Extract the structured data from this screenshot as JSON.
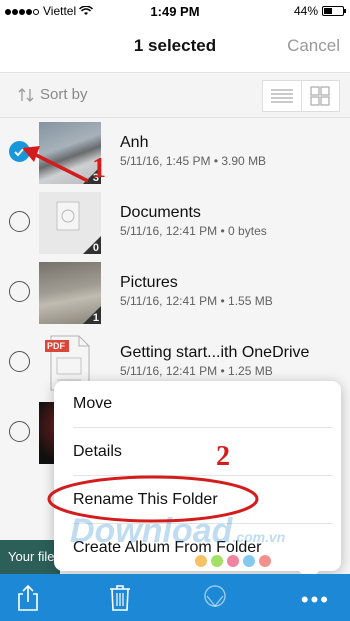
{
  "status": {
    "carrier": "Viettel",
    "time": "1:49 PM",
    "battery": "44%"
  },
  "nav": {
    "title": "1 selected",
    "cancel": "Cancel"
  },
  "sort": {
    "label": "Sort by"
  },
  "items": [
    {
      "name": "Anh",
      "meta": "5/11/16, 1:45 PM • 3.90 MB",
      "count": "3",
      "selected": true
    },
    {
      "name": "Documents",
      "meta": "5/11/16, 12:41 PM • 0 bytes",
      "count": "0",
      "selected": false
    },
    {
      "name": "Pictures",
      "meta": "5/11/16, 12:41 PM • 1.55 MB",
      "count": "1",
      "selected": false
    },
    {
      "name": "Getting start...ith OneDrive",
      "meta": "5/11/16, 12:41 PM • 1.25 MB",
      "count": "",
      "selected": false,
      "badge": "PDF"
    },
    {
      "name": "",
      "meta": "",
      "count": "",
      "selected": false
    }
  ],
  "menu": {
    "move": "Move",
    "details": "Details",
    "rename": "Rename This Folder",
    "create_album": "Create Album From Folder"
  },
  "banner": {
    "text": "Your files"
  },
  "annotations": {
    "one": "1",
    "two": "2"
  },
  "watermark": {
    "main": "Download",
    "suffix": ".com.vn"
  },
  "colors": {
    "accent": "#1a9fe3",
    "toolbar": "#1d89d6",
    "annotation": "#d31d1d"
  },
  "icons": [
    "wifi-icon",
    "battery-icon",
    "sort-icon",
    "list-view-icon",
    "grid-view-icon",
    "checkmark-icon",
    "share-icon",
    "trash-icon",
    "album-icon",
    "more-icon"
  ]
}
